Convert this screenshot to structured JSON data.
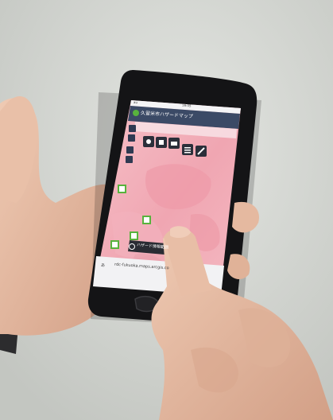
{
  "colors": {
    "wall": "#d6d8d4",
    "skin": "#e7bfa6",
    "skin_shadow": "#c99b83",
    "phone_body": "#141416",
    "map_pink": "#f1a9b4",
    "header_bar": "#3b4a66",
    "accent_green": "#58b33d"
  },
  "status_bar": {
    "carrier": "au",
    "time": "16:05"
  },
  "app_header": {
    "title": "久留米市ハザードマップ"
  },
  "toolbar": {
    "icons": [
      "layers-icon",
      "grid-icon",
      "print-icon",
      "list-icon",
      "pen-icon"
    ]
  },
  "map": {
    "marker_labels": [
      "",
      "",
      "",
      ""
    ],
    "town_label": "",
    "popup_label": "ハザード情報範囲"
  },
  "browser_bar": {
    "prefix": "あ",
    "url": "rdc-fukuoka.maps.arcgis.co"
  }
}
